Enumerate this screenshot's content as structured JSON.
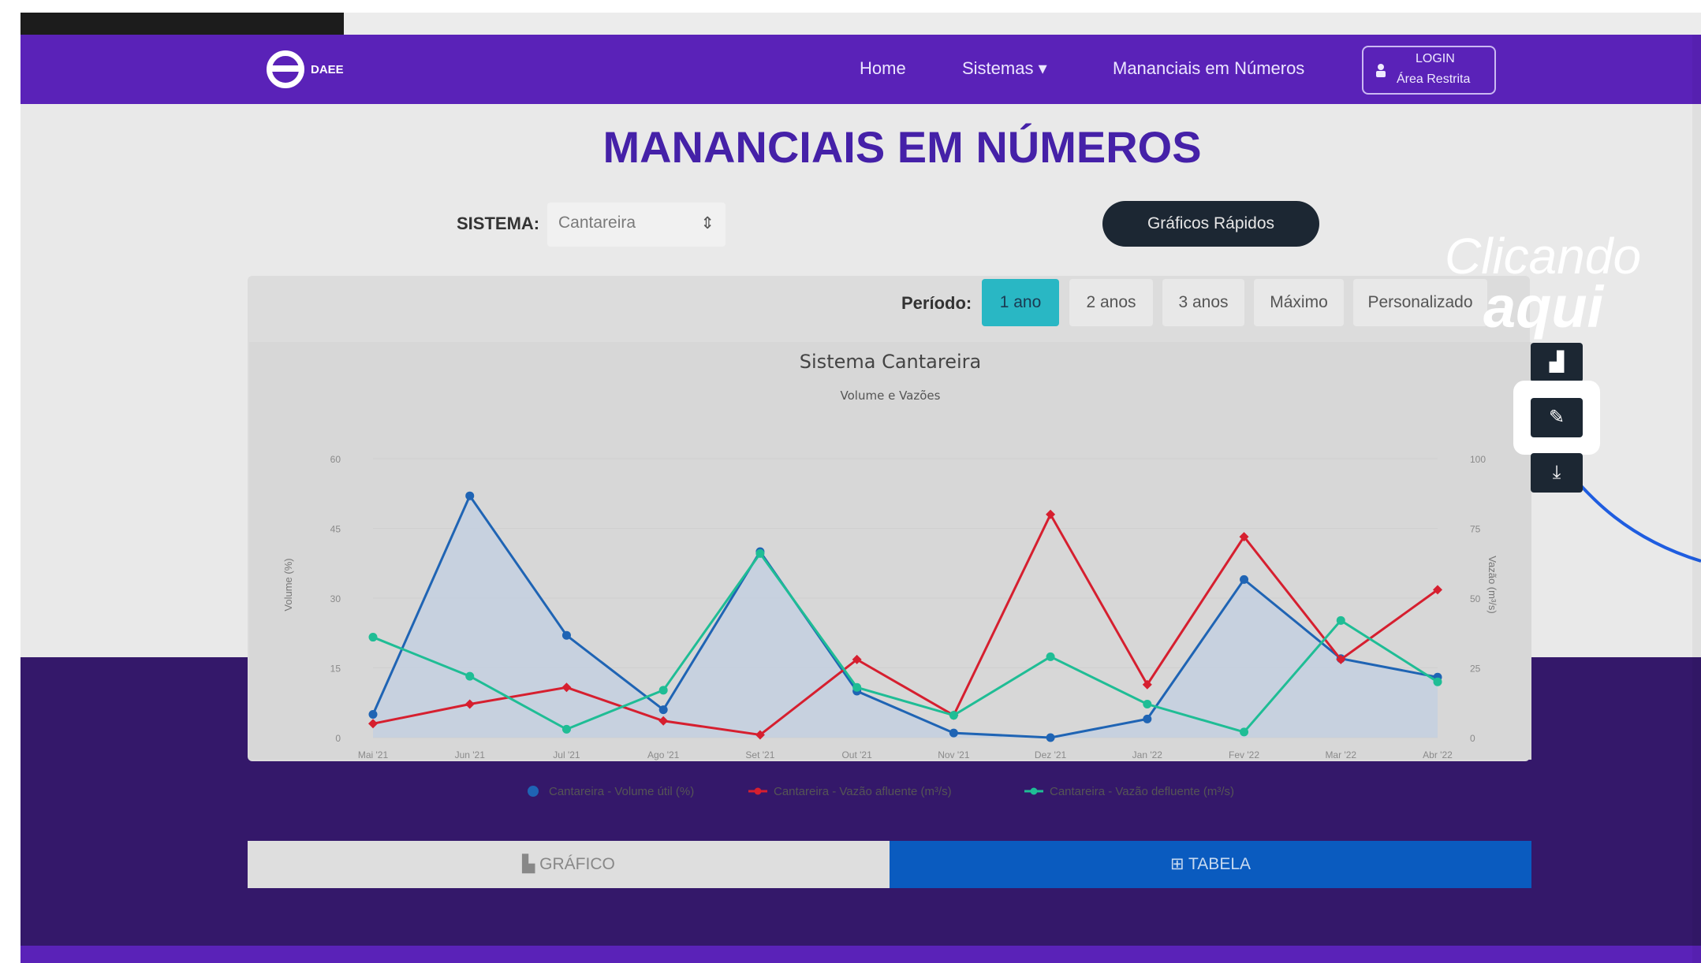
{
  "navbar": {
    "logo_text": "DAEE",
    "home": "Home",
    "sistemas": "Sistemas ▾",
    "mananciais": "Mananciais em Números",
    "login_line1": "LOGIN",
    "login_line2": "Área Restrita"
  },
  "page": {
    "title": "MANANCIAIS EM NÚMEROS",
    "sistema_label": "SISTEMA:",
    "sistema_value": "Cantareira",
    "quick_charts": "Gráficos Rápidos",
    "periodo_label": "Período:",
    "periodo_options": [
      "1 ano",
      "2 anos",
      "3 anos",
      "Máximo",
      "Personalizado"
    ],
    "periodo_selected": "1 ano"
  },
  "tabs": {
    "grafico": "GRÁFICO",
    "tabela": "TABELA"
  },
  "annotation": {
    "line1": "Clicando",
    "line2": "aqui"
  },
  "side_buttons": [
    "chart-icon",
    "brush-icon",
    "download-icon"
  ],
  "colors": {
    "navbar": "#5a22b8",
    "volume": "#1f64b4",
    "afluente": "#d61f2f",
    "defluente": "#1fbd95",
    "annotation_arrow": "#1f5de0"
  },
  "chart_data": {
    "type": "line",
    "title": "Sistema Cantareira",
    "subtitle": "Volume e Vazões",
    "xlabel": "",
    "ylabel_left": "Volume (%)",
    "ylabel_right": "Vazão (m³/s)",
    "categories": [
      "Mai '21",
      "Jun '21",
      "Jul '21",
      "Ago '21",
      "Set '21",
      "Out '21",
      "Nov '21",
      "Dez '21",
      "Jan '22",
      "Fev '22",
      "Mar '22",
      "Abr '22"
    ],
    "y_left_ticks": [
      "0",
      "15",
      "30",
      "45",
      "60"
    ],
    "y_right_ticks": [
      "0",
      "25",
      "50",
      "75",
      "100"
    ],
    "ylim_left": [
      0,
      60
    ],
    "ylim_right": [
      0,
      100
    ],
    "legend_position": "bottom",
    "series": [
      {
        "name": "Cantareira - Volume útil (%)",
        "axis": "left",
        "area": true,
        "values": [
          5,
          52,
          22,
          6,
          40,
          10,
          1,
          0,
          4,
          34,
          17,
          13
        ]
      },
      {
        "name": "Cantareira - Vazão afluente (m³/s)",
        "axis": "right",
        "area": false,
        "values": [
          5,
          12,
          18,
          6,
          1,
          28,
          8,
          80,
          19,
          72,
          28,
          53
        ]
      },
      {
        "name": "Cantareira - Vazão defluente (m³/s)",
        "axis": "right",
        "area": false,
        "values": [
          36,
          22,
          3,
          17,
          66,
          18,
          8,
          29,
          12,
          2,
          42,
          20
        ]
      }
    ]
  }
}
